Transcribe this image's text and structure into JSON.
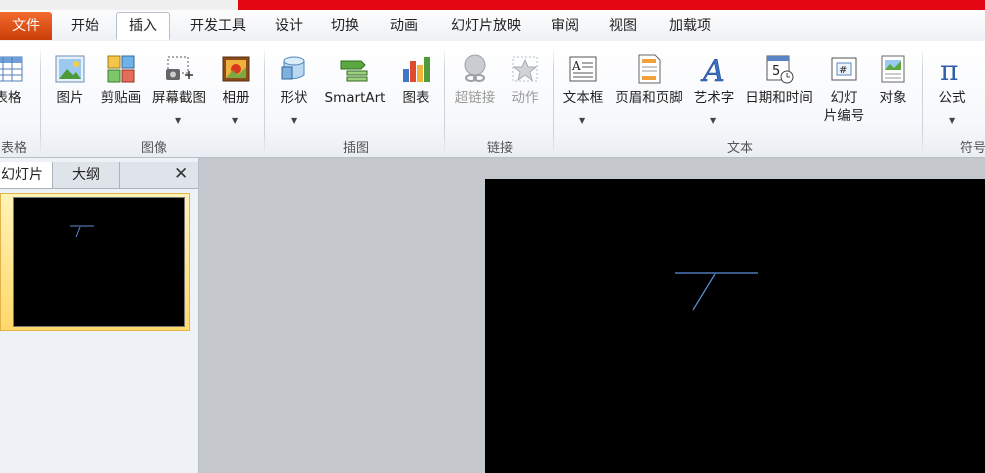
{
  "tabs": {
    "file": "文件",
    "home": "开始",
    "insert": "插入",
    "developer": "开发工具",
    "design": "设计",
    "transitions": "切换",
    "animations": "动画",
    "slideshow": "幻灯片放映",
    "review": "审阅",
    "view": "视图",
    "addins": "加载项"
  },
  "ribbon": {
    "table": {
      "label": "表格",
      "group": "表格"
    },
    "images": {
      "picture": "图片",
      "clipart": "剪贴画",
      "screenshot": "屏幕截图",
      "album": "相册",
      "group": "图像"
    },
    "illustrations": {
      "shapes": "形状",
      "smartart": "SmartArt",
      "chart": "图表",
      "group": "插图"
    },
    "links": {
      "hyperlink": "超链接",
      "action": "动作",
      "group": "链接"
    },
    "text": {
      "textbox": "文本框",
      "headerfooter": "页眉和页脚",
      "wordart": "艺术字",
      "datetime": "日期和时间",
      "slidenumber_line1": "幻灯",
      "slidenumber_line2": "片编号",
      "object": "对象",
      "group": "文本"
    },
    "symbols": {
      "equation": "公式",
      "group": "符号"
    }
  },
  "pane": {
    "slides_tab": "幻灯片",
    "outline_tab": "大纲"
  },
  "colors": {
    "file_tab": "#d9501a",
    "accent_red": "#e30613",
    "slide_bg": "#000000",
    "shape_stroke": "#5b8fd9"
  }
}
